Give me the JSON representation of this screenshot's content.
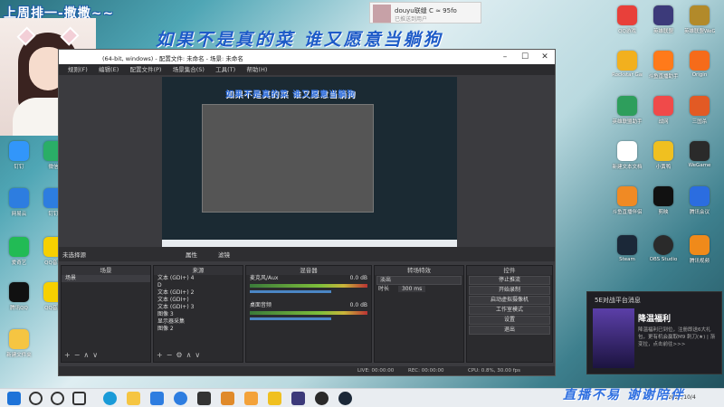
{
  "overlay": {
    "cat_title": "上周排一-撒撒~~",
    "slogan": "如果不是真的菜 谁又愿意当躺狗",
    "footer_slogan": "直播不易 谢谢陪伴"
  },
  "notification_top": {
    "name": "douyu联缝 C ≈ 95fo",
    "subtitle": "已推送到用户"
  },
  "obs": {
    "window_title": "(64-bit, windows) - 配置文件: 未命名 - 场景: 未命名",
    "menu": [
      "规则(F)",
      "编辑(E)",
      "配置文件(P)",
      "场景集合(S)",
      "工具(T)",
      "帮助(H)"
    ],
    "no_source_label": "未选择源",
    "properties_label": "属性",
    "filters_label": "滤镜",
    "preview_slogan": "如果不是真的菜 谁又愿意当躺狗",
    "docks": {
      "scenes": {
        "title": "场景",
        "items": [
          "场景"
        ]
      },
      "sources": {
        "title": "来源",
        "items": [
          "文本 (GDI+) 4",
          "D",
          "文本 (GDI+) 2",
          "文本 (GDI+)",
          "文本 (GDI+) 3",
          "图像 3",
          "显示器采集",
          "图像 2"
        ]
      },
      "mixer": {
        "title": "混音器",
        "channels": [
          {
            "name": "麦克风/Aux",
            "db": "0.0 dB"
          },
          {
            "name": "桌面音频",
            "db": "0.0 dB"
          }
        ]
      },
      "transitions": {
        "title": "转场特效",
        "type": "淡出",
        "duration_label": "时长",
        "duration": "300 ms"
      },
      "controls": {
        "title": "控件",
        "buttons": [
          "停止推流",
          "开始录制",
          "启动虚拟摄像机",
          "工作室模式",
          "设置",
          "退出"
        ]
      }
    },
    "status": {
      "live": "LIVE: 00:00:00",
      "rec": "REC: 00:00:00",
      "cpu": "CPU: 0.8%, 30.00 fps"
    }
  },
  "desktop_icons": [
    {
      "label": "QQ游戏",
      "color": "#e8403a"
    },
    {
      "label": "英雄联盟",
      "color": "#3c3a7a"
    },
    {
      "label": "英雄联盟WeGame",
      "color": "#b28a2a"
    },
    {
      "label": "Rockstar Games",
      "color": "#f2b01e"
    },
    {
      "label": "斗鱼直播助手",
      "color": "#ff7a1a"
    },
    {
      "label": "Origin",
      "color": "#f56b1a"
    },
    {
      "label": "英雄联盟助手",
      "color": "#2e9e5c"
    },
    {
      "label": "战网",
      "color": "#f04a4a"
    },
    {
      "label": "三国杀",
      "color": "#e25a24"
    },
    {
      "label": "新建文本文档",
      "color": "#ffffff"
    },
    {
      "label": "小黄鸭",
      "color": "#f0c020"
    },
    {
      "label": "WeGame",
      "color": "#2a2a2a"
    },
    {
      "label": "斗鱼直播伴侣",
      "color": "#f08a24"
    },
    {
      "label": "剪映",
      "color": "#111111"
    },
    {
      "label": "腾讯会议",
      "color": "#2b6de0"
    },
    {
      "label": "Steam",
      "color": "#1b2838"
    },
    {
      "label": "OBS Studio",
      "color": "#2a2a2a"
    },
    {
      "label": "腾讯视频",
      "color": "#f08a1a"
    },
    {
      "label": "钉钉",
      "color": "#3296fa"
    },
    {
      "label": "微信",
      "color": "#2aae67"
    },
    {
      "label": "网易云",
      "color": "#2d7de0"
    },
    {
      "label": "钉钉",
      "color": "#2d7de0"
    },
    {
      "label": "爱奇艺",
      "color": "#22bb55"
    },
    {
      "label": "QQ音乐",
      "color": "#f7d000"
    },
    {
      "label": "腾讯QQ",
      "color": "#111111"
    },
    {
      "label": "QQ音乐",
      "color": "#f7d000"
    },
    {
      "label": "新建文件夹",
      "color": "#f5c542"
    }
  ],
  "notification": {
    "header": "5E对战平台消息",
    "title": "降温福利",
    "text": "降温福利已到位，注册即送6大礼包，更有机会赢取M9 刺刀(★) | 渐变拉，点击前往>>>"
  },
  "clock": "2021/10/4",
  "taskbar_apps": [
    "start",
    "search",
    "task-view",
    "edge",
    "explorer",
    "mail",
    "clock",
    "store",
    "photo",
    "game",
    "douyu",
    "lol",
    "obs",
    "steam"
  ]
}
